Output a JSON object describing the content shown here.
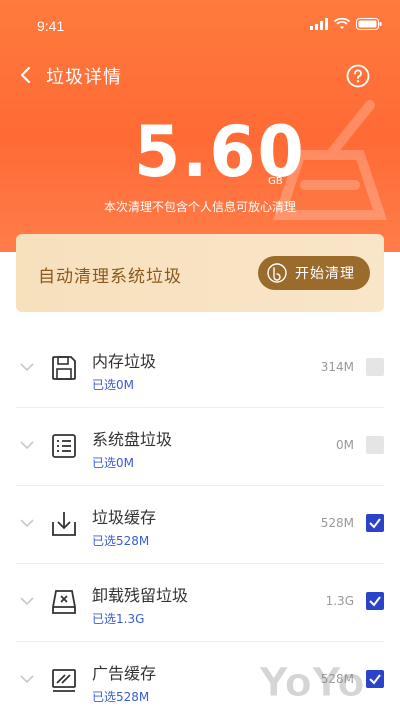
{
  "statusbar": {
    "time": "9:41"
  },
  "nav": {
    "title": "垃圾详情"
  },
  "summary": {
    "size": "5.60",
    "unit": "GB",
    "subtitle": "本次清理不包含个人信息可放心清理"
  },
  "auto_clean": {
    "text": "自动清理系统垃圾",
    "button": "开始清理"
  },
  "items": [
    {
      "title": "内存垃圾",
      "selected": "已选0M",
      "size": "314M",
      "checked": false,
      "icon": "floppy-disk-icon"
    },
    {
      "title": "系统盘垃圾",
      "selected": "已选0M",
      "size": "0M",
      "checked": false,
      "icon": "list-icon"
    },
    {
      "title": "垃圾缓存",
      "selected": "已选528M",
      "size": "528M",
      "checked": true,
      "icon": "download-tray-icon"
    },
    {
      "title": "卸载残留垃圾",
      "selected": "已选1.3G",
      "size": "1.3G",
      "checked": true,
      "icon": "uninstall-box-icon"
    },
    {
      "title": "广告缓存",
      "selected": "已选528M",
      "size": "528M",
      "checked": true,
      "icon": "ad-chart-icon"
    }
  ],
  "watermark": "YoYo",
  "colors": {
    "accent": "#ff6a35",
    "gold": "#9a6b2a",
    "checked": "#2b43c8",
    "selected_text": "#3b5bd6"
  }
}
